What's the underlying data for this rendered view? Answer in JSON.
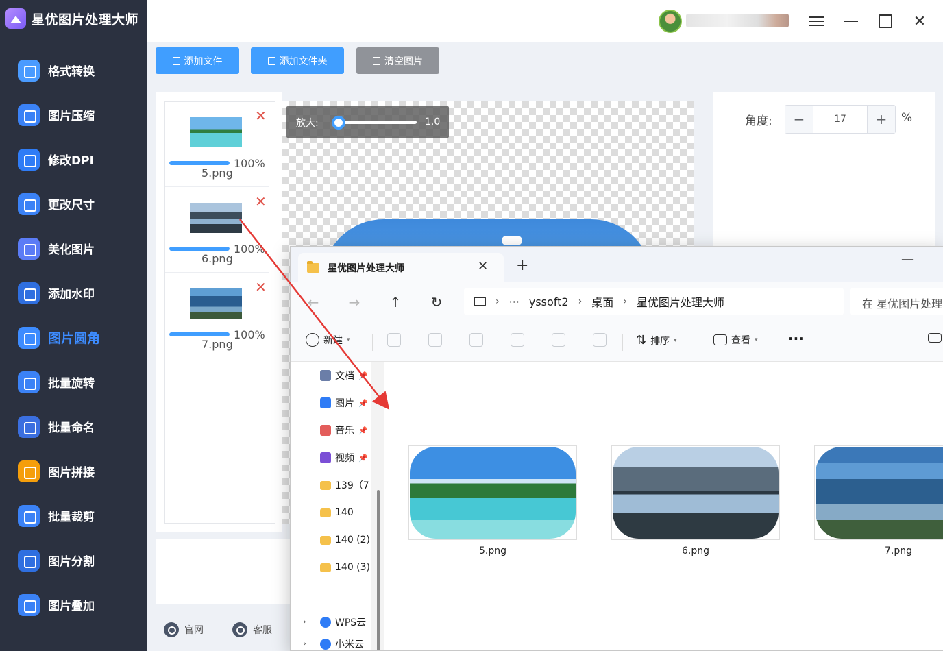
{
  "app": {
    "title": "星优图片处理大师",
    "sidebar": [
      {
        "label": "格式转换",
        "icon": "image-convert-icon",
        "color": "#4a9bff"
      },
      {
        "label": "图片压缩",
        "icon": "image-compress-icon",
        "color": "#3b82f6"
      },
      {
        "label": "修改DPI",
        "icon": "dpi-icon",
        "color": "#2f7cf6"
      },
      {
        "label": "更改尺寸",
        "icon": "resize-icon",
        "color": "#3b82f6"
      },
      {
        "label": "美化图片",
        "icon": "beautify-icon",
        "color": "#5b7cf6"
      },
      {
        "label": "添加水印",
        "icon": "watermark-icon",
        "color": "#2f6fe0"
      },
      {
        "label": "图片圆角",
        "icon": "rounded-corner-icon",
        "color": "#3d8cff"
      },
      {
        "label": "批量旋转",
        "icon": "rotate-icon",
        "color": "#3b82f6"
      },
      {
        "label": "批量命名",
        "icon": "rename-icon",
        "color": "#3b6fe0"
      },
      {
        "label": "图片拼接",
        "icon": "puzzle-icon",
        "color": "#f59e0b"
      },
      {
        "label": "批量裁剪",
        "icon": "crop-icon",
        "color": "#3b82f6"
      },
      {
        "label": "图片分割",
        "icon": "split-icon",
        "color": "#2f6fe0"
      },
      {
        "label": "图片叠加",
        "icon": "layers-icon",
        "color": "#3b82f6"
      }
    ],
    "active_index": 6,
    "toolbar": {
      "add_file": "添加文件",
      "add_folder": "添加文件夹",
      "clear": "清空图片"
    },
    "files": [
      {
        "name": "5.png",
        "progress": "100%",
        "progress_value": 100
      },
      {
        "name": "6.png",
        "progress": "100%",
        "progress_value": 100
      },
      {
        "name": "7.png",
        "progress": "100%",
        "progress_value": 100
      }
    ],
    "zoom": {
      "label": "放大:",
      "value": "1.0"
    },
    "angle": {
      "label": "角度:",
      "value": "17",
      "unit": "%",
      "minus": "−",
      "plus": "+"
    },
    "footer": {
      "website": "官网",
      "support": "客服"
    },
    "colors": {
      "accent": "#409eff",
      "sidebar_bg": "#2b3140",
      "clear_btn": "#909399",
      "remove": "#e0534a"
    }
  },
  "explorer": {
    "tab_title": "星优图片处理大师",
    "new_tab": "+",
    "path": {
      "root": "···",
      "crumbs": [
        "yssoft2",
        "桌面",
        "星优图片处理大师"
      ]
    },
    "search_placeholder": "在 星优图片处理",
    "commands": {
      "new": "新建",
      "sort": "排序",
      "view": "查看",
      "more": "···"
    },
    "nav": [
      {
        "label": "文档",
        "pinned": true,
        "color": "#6b7ea8"
      },
      {
        "label": "图片",
        "pinned": true,
        "color": "#2f7cf6"
      },
      {
        "label": "音乐",
        "pinned": true,
        "color": "#e35d5b"
      },
      {
        "label": "视频",
        "pinned": true,
        "color": "#7b4fd6"
      },
      {
        "label": "139（7",
        "pinned": false,
        "color": "#f5c14b"
      },
      {
        "label": "140",
        "pinned": false,
        "color": "#f5c14b"
      },
      {
        "label": "140 (2)",
        "pinned": false,
        "color": "#f5c14b"
      },
      {
        "label": "140 (3)",
        "pinned": false,
        "color": "#f5c14b"
      }
    ],
    "nav_bottom": [
      {
        "label": "WPS云",
        "color": "#2f7cf6"
      },
      {
        "label": "小米云",
        "color": "#2f7cf6"
      }
    ],
    "files": [
      {
        "name": "5.png"
      },
      {
        "name": "6.png"
      },
      {
        "name": "7.png"
      }
    ]
  }
}
